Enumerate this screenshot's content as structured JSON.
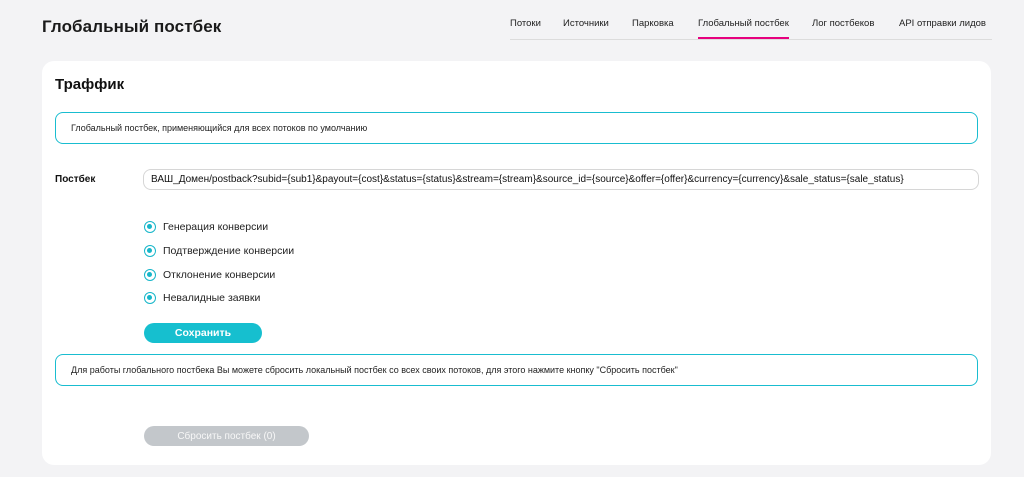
{
  "header": {
    "title": "Глобальный постбек",
    "tabs": [
      {
        "label": "Потоки",
        "active": false
      },
      {
        "label": "Источники",
        "active": false
      },
      {
        "label": "Парковка",
        "active": false
      },
      {
        "label": "Глобальный постбек",
        "active": true
      },
      {
        "label": "Лог постбеков",
        "active": false
      },
      {
        "label": "API отправки лидов",
        "active": false
      }
    ]
  },
  "card": {
    "title": "Траффик",
    "info_top": "Глобальный постбек, применяющийся для всех потоков по умолчанию",
    "postback_label": "Постбек",
    "postback_value": "ВАШ_Домен/postback?subid={sub1}&payout={cost}&status={status}&stream={stream}&source_id={source}&offer={offer}&currency={currency}&sale_status={sale_status}",
    "options": [
      {
        "label": "Генерация конверсии",
        "checked": true
      },
      {
        "label": "Подтверждение конверсии",
        "checked": true
      },
      {
        "label": "Отклонение конверсии",
        "checked": true
      },
      {
        "label": "Невалидные заявки",
        "checked": true
      }
    ],
    "save_label": "Сохранить",
    "info_bottom": "Для работы глобального постбека Вы можете сбросить локальный постбек со всех своих потоков, для этого нажмите кнопку \"Сбросить постбек\"",
    "reset_label": "Сбросить постбек (0)"
  },
  "colors": {
    "accent": "#16bfcf",
    "active_tab_underline": "#e6007e",
    "disabled_button": "#c3c7cb"
  }
}
